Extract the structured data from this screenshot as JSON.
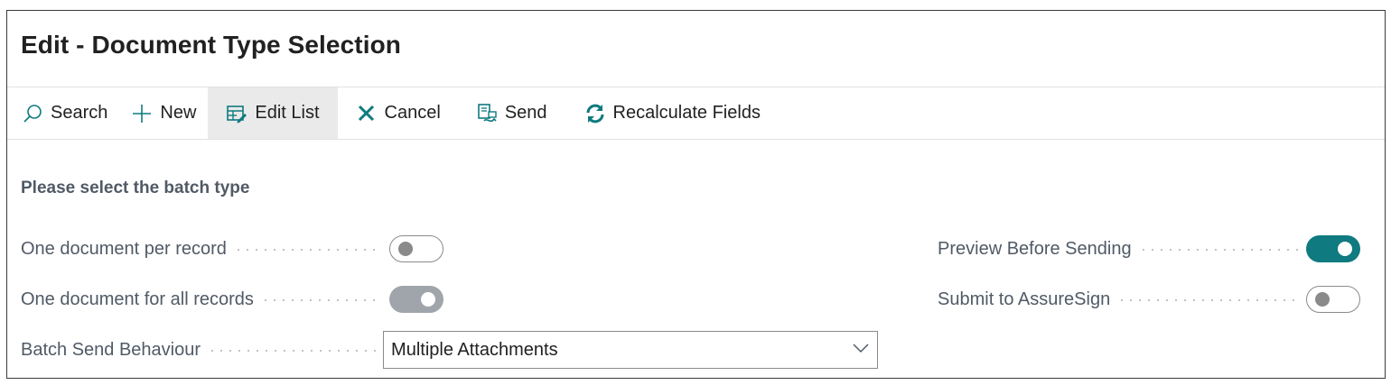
{
  "window": {
    "title": "Edit - Document Type Selection"
  },
  "toolbar": {
    "search": {
      "label": "Search",
      "icon": "search-icon"
    },
    "new": {
      "label": "New",
      "icon": "plus-icon"
    },
    "edit_list": {
      "label": "Edit List",
      "icon": "edit-list-icon"
    },
    "cancel": {
      "label": "Cancel",
      "icon": "close-icon"
    },
    "send": {
      "label": "Send",
      "icon": "send-document-icon"
    },
    "recalculate": {
      "label": "Recalculate Fields",
      "icon": "refresh-icon"
    }
  },
  "section": {
    "label": "Please select the batch type"
  },
  "fields": {
    "one_per_record": {
      "label": "One document per record",
      "value": false
    },
    "one_for_all": {
      "label": "One document for all records",
      "value": true
    },
    "batch_send": {
      "label": "Batch Send Behaviour",
      "value": "Multiple Attachments"
    },
    "preview": {
      "label": "Preview Before Sending",
      "value": true
    },
    "submit_assuresign": {
      "label": "Submit to AssureSign",
      "value": false
    }
  },
  "colors": {
    "accent": "#0f7a7f",
    "toggle_disabled_on": "#a0a5ab",
    "label": "#505a66"
  }
}
